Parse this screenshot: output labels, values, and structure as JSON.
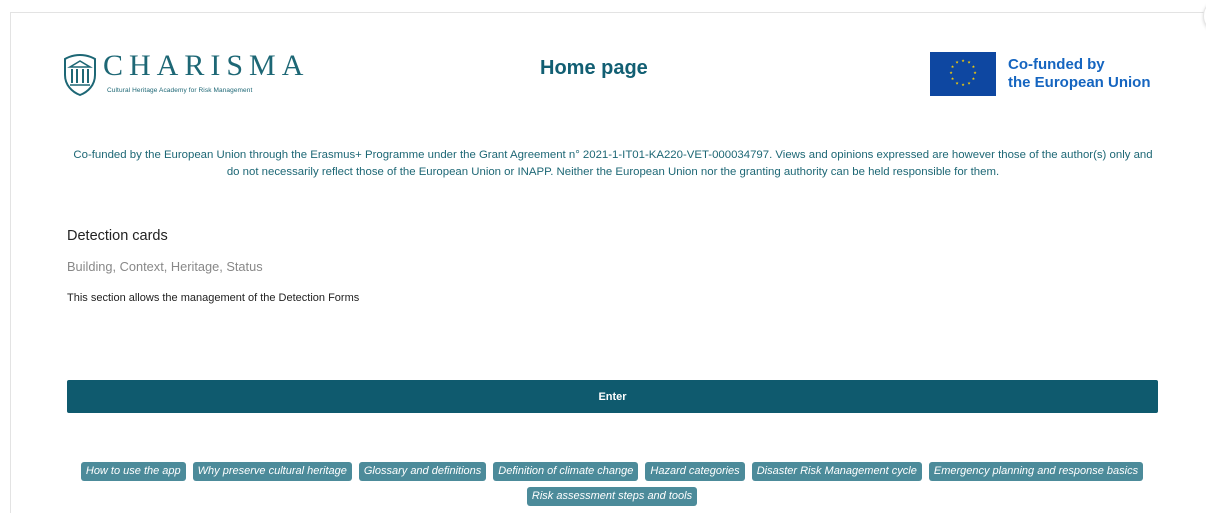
{
  "header": {
    "logo": {
      "name": "CHARISMA",
      "subtitle": "Cultural Heritage Academy for Risk Management",
      "icon": "temple-shield-icon"
    },
    "title": "Home page",
    "eu_badge": {
      "line1": "Co-funded by",
      "line2": "the European Union",
      "icon": "eu-flag-icon",
      "flag_color": "#0e47a1",
      "star_color": "#ffd200"
    }
  },
  "disclaimer": {
    "line1": "Co-funded by the European Union through the Erasmus+ Programme under the Grant Agreement n° 2021-1-IT01-KA220-VET-000034797. Views and opinions expressed are however those of the author(s) only and",
    "line2": "do not necessarily reflect those of the European Union or INAPP. Neither the European Union nor the granting authority can be held responsible for them."
  },
  "section": {
    "title": "Detection cards",
    "tags": "Building, Context, Heritage, Status",
    "description": "This section allows the management of the Detection Forms",
    "enter_label": "Enter"
  },
  "links": [
    "How to use the app",
    "Why preserve cultural heritage",
    "Glossary and definitions",
    "Definition of climate change",
    "Hazard categories",
    "Disaster Risk Management cycle",
    "Emergency planning and response basics",
    "Risk assessment steps and tools"
  ],
  "colors": {
    "primary": "#0f5a6e",
    "chip": "#4c8b9a",
    "brand_text": "#1d6775",
    "eu_text": "#1565c0"
  }
}
